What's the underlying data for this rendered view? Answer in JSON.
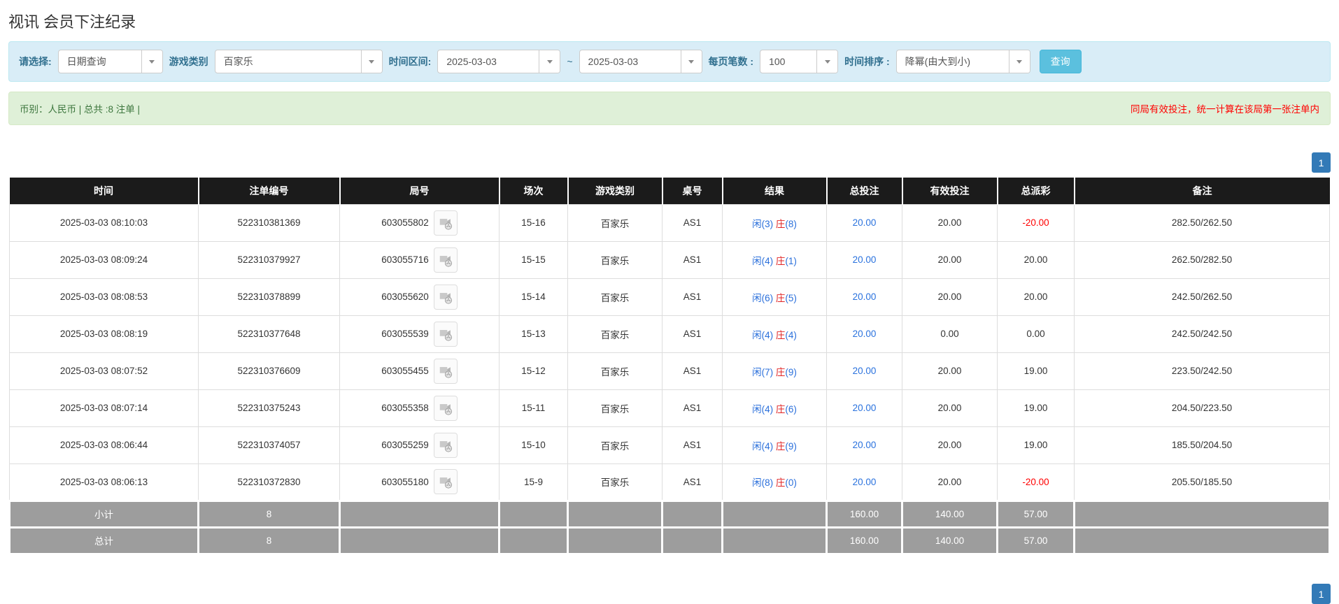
{
  "page": {
    "title": "视讯 会员下注纪录"
  },
  "filters": {
    "select_label": "请选择:",
    "select_value": "日期查询",
    "game_label": "游戏类别",
    "game_value": "百家乐",
    "range_label": "时间区间:",
    "date_from": "2025-03-03",
    "tilde": "~",
    "date_to": "2025-03-03",
    "per_page_label": "每页笔数 :",
    "per_page_value": "100",
    "sort_label": "时间排序 :",
    "sort_value": "降幂(由大到小)",
    "search_button": "查询"
  },
  "summary": {
    "left": "币别：人民币 | 总共 :8 注单 |",
    "right": "同局有效投注，统一计算在该局第一张注单内"
  },
  "pagination": {
    "page": "1"
  },
  "colors": {
    "accent_blue": "#5bc0de",
    "link_blue": "#2a72de",
    "result_player_blue": "#2a6fdb",
    "result_banker_red": "#e02525",
    "negative_red": "#ff0000",
    "header_bg": "#1b1b1b",
    "footer_bg": "#9d9d9d",
    "success_bg": "#dff0d8",
    "info_bg": "#d9edf7"
  },
  "icons": {
    "dropdown_caret": "caret-down",
    "round_video": "video-replay-icon"
  },
  "table": {
    "headers": [
      "时间",
      "注单编号",
      "局号",
      "场次",
      "游戏类别",
      "桌号",
      "结果",
      "总投注",
      "有效投注",
      "总派彩",
      "备注"
    ],
    "rows": [
      {
        "time": "2025-03-03 08:10:03",
        "bet_id": "522310381369",
        "round": "603055802",
        "session": "15-16",
        "game": "百家乐",
        "table_no": "AS1",
        "result_player": "闲(3)",
        "result_banker": "庄(8)",
        "total_bet": "20.00",
        "valid_bet": "20.00",
        "payout": "-20.00",
        "note": "282.50/262.50"
      },
      {
        "time": "2025-03-03 08:09:24",
        "bet_id": "522310379927",
        "round": "603055716",
        "session": "15-15",
        "game": "百家乐",
        "table_no": "AS1",
        "result_player": "闲(4)",
        "result_banker": "庄(1)",
        "total_bet": "20.00",
        "valid_bet": "20.00",
        "payout": "20.00",
        "note": "262.50/282.50"
      },
      {
        "time": "2025-03-03 08:08:53",
        "bet_id": "522310378899",
        "round": "603055620",
        "session": "15-14",
        "game": "百家乐",
        "table_no": "AS1",
        "result_player": "闲(6)",
        "result_banker": "庄(5)",
        "total_bet": "20.00",
        "valid_bet": "20.00",
        "payout": "20.00",
        "note": "242.50/262.50"
      },
      {
        "time": "2025-03-03 08:08:19",
        "bet_id": "522310377648",
        "round": "603055539",
        "session": "15-13",
        "game": "百家乐",
        "table_no": "AS1",
        "result_player": "闲(4)",
        "result_banker": "庄(4)",
        "total_bet": "20.00",
        "valid_bet": "0.00",
        "payout": "0.00",
        "note": "242.50/242.50"
      },
      {
        "time": "2025-03-03 08:07:52",
        "bet_id": "522310376609",
        "round": "603055455",
        "session": "15-12",
        "game": "百家乐",
        "table_no": "AS1",
        "result_player": "闲(7)",
        "result_banker": "庄(9)",
        "total_bet": "20.00",
        "valid_bet": "20.00",
        "payout": "19.00",
        "note": "223.50/242.50"
      },
      {
        "time": "2025-03-03 08:07:14",
        "bet_id": "522310375243",
        "round": "603055358",
        "session": "15-11",
        "game": "百家乐",
        "table_no": "AS1",
        "result_player": "闲(4)",
        "result_banker": "庄(6)",
        "total_bet": "20.00",
        "valid_bet": "20.00",
        "payout": "19.00",
        "note": "204.50/223.50"
      },
      {
        "time": "2025-03-03 08:06:44",
        "bet_id": "522310374057",
        "round": "603055259",
        "session": "15-10",
        "game": "百家乐",
        "table_no": "AS1",
        "result_player": "闲(4)",
        "result_banker": "庄(9)",
        "total_bet": "20.00",
        "valid_bet": "20.00",
        "payout": "19.00",
        "note": "185.50/204.50"
      },
      {
        "time": "2025-03-03 08:06:13",
        "bet_id": "522310372830",
        "round": "603055180",
        "session": "15-9",
        "game": "百家乐",
        "table_no": "AS1",
        "result_player": "闲(8)",
        "result_banker": "庄(0)",
        "total_bet": "20.00",
        "valid_bet": "20.00",
        "payout": "-20.00",
        "note": "205.50/185.50"
      }
    ],
    "subtotal": {
      "label": "小计",
      "count": "8",
      "total_bet": "160.00",
      "valid_bet": "140.00",
      "payout": "57.00"
    },
    "total": {
      "label": "总计",
      "count": "8",
      "total_bet": "160.00",
      "valid_bet": "140.00",
      "payout": "57.00"
    }
  }
}
